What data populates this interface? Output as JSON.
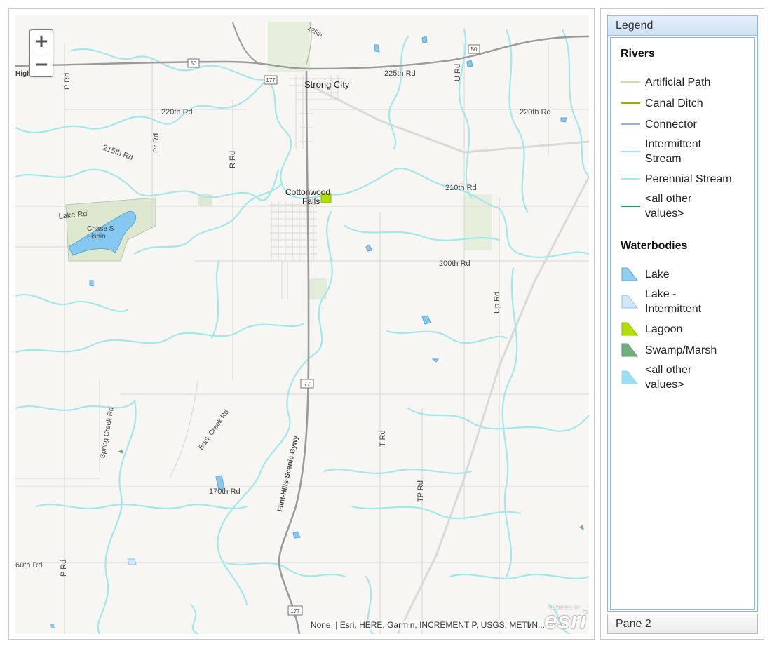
{
  "map": {
    "zoom_in": "+",
    "zoom_out": "−",
    "attribution": "None. | Esri, HERE, Garmin, INCREMENT P, USGS, METI/N...",
    "logo_powered": "POWERED BY",
    "logo_word": "esri",
    "labels": {
      "strong_city": "Strong City",
      "cottonwood": "Cottonwood",
      "falls": "Falls",
      "chase1": "Chase S",
      "chase2": "Fishin",
      "highway_prefix": "High",
      "rd_225": "225th Rd",
      "rd_220_left": "220th Rd",
      "rd_220_right": "220th Rd",
      "rd_215": "215th Rd",
      "rd_210": "210th Rd",
      "rd_200": "200th Rd",
      "rd_170": "170th Rd",
      "rd_160": "60th Rd",
      "lake_rd": "Lake Rd",
      "p_rd_top": "P Rd",
      "p_rd_bottom": "P Rd",
      "pr_rd": "Pr Rd",
      "r_rd": "R Rd",
      "u_rd": "U Rd",
      "up_rd": "Up Rd",
      "t_rd": "T Rd",
      "tp_rd": "TP Rd",
      "spring_creek": "Spring Creek Rd",
      "buck_creek": "Buck Creek Rd",
      "byway": "Flint-Hills-Scenic-Bywy",
      "rd_125": "125th",
      "hwy_50a": "50",
      "hwy_50b": "50",
      "hwy_177a": "177",
      "hwy_177b": "77",
      "hwy_177c": "177"
    }
  },
  "legend": {
    "title": "Legend",
    "rivers_title": "Rivers",
    "rivers": [
      {
        "label1": "Artificial Path",
        "label2": "",
        "color": "#d2d8a6"
      },
      {
        "label1": "Canal Ditch",
        "label2": "",
        "color": "#a3ab00"
      },
      {
        "label1": "Connector",
        "label2": "",
        "color": "#9ea9e8"
      },
      {
        "label1": "Intermittent",
        "label2": "Stream",
        "color": "#9fe3f2"
      },
      {
        "label1": "Perennial Stream",
        "label2": "",
        "color": "#9ff0f0"
      },
      {
        "label1": "<all other",
        "label2": "values>",
        "color": "#1a9a80"
      }
    ],
    "waterbodies_title": "Waterbodies",
    "waterbodies": [
      {
        "label1": "Lake",
        "label2": "",
        "fill": "#8fd0f2",
        "stroke": "#5aa7d8"
      },
      {
        "label1": "Lake -",
        "label2": "Intermittent",
        "fill": "#cfe9fb",
        "stroke": "#8ec2e8"
      },
      {
        "label1": "Lagoon",
        "label2": "",
        "fill": "#b2df00",
        "stroke": "#8fb800"
      },
      {
        "label1": "Swamp/Marsh",
        "label2": "",
        "fill": "#6fb07a",
        "stroke": "#5a9865"
      },
      {
        "label1": "<all other",
        "label2": "values>",
        "fill": "#99ddf5",
        "stroke": "#99ddf5"
      }
    ]
  },
  "pane2": {
    "title": "Pane 2"
  },
  "colors": {
    "stream": "#9fe8ec",
    "lake": "#86c8f0",
    "road_major": "#9a9a9a",
    "road_minor": "#dcdcdc",
    "park": "#e3ecd8"
  }
}
